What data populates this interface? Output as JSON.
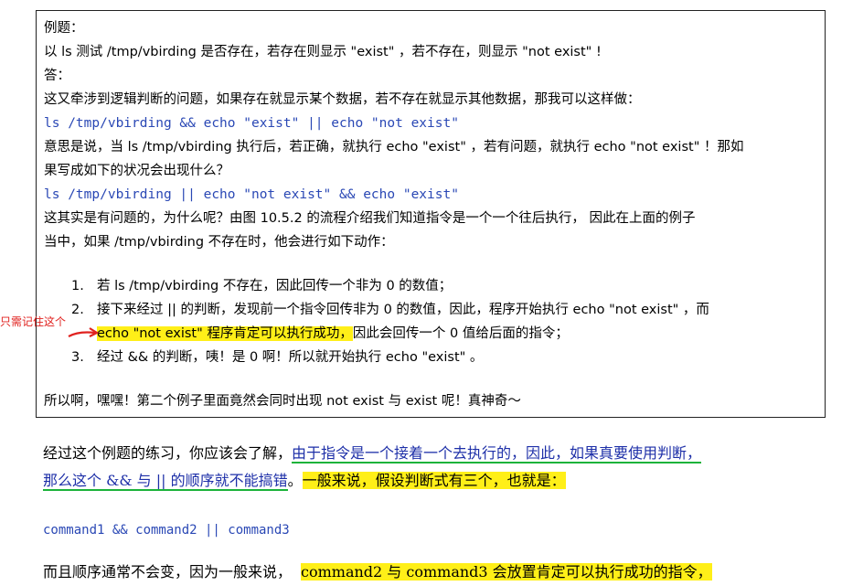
{
  "box": {
    "title": "例题：",
    "question": "以 ls 测试 /tmp/vbirding 是否存在，若存在则显示 \"exist\" ，若不存在，则显示 \"not exist\" !",
    "answer_label": "答：",
    "line1": "这又牵涉到逻辑判断的问题，如果存在就显示某个数据，若不存在就显示其他数据，那我可以这样做：",
    "code1": "ls /tmp/vbirding && echo \"exist\" || echo \"not exist\"",
    "line2a": "意思是说，当 ls /tmp/vbirding 执行后，若正确，就执行 echo \"exist\" ，若有问题，就执行 echo \"not exist\" ！那如",
    "line2b": "果写成如下的状况会出现什么？",
    "code2": "ls /tmp/vbirding || echo \"not exist\" && echo \"exist\"",
    "line3a": "这其实是有问题的，为什么呢？由图 10.5.2 的流程介绍我们知道指令是一个一个往后执行， 因此在上面的例子",
    "line3b": "当中，如果 /tmp/vbirding 不存在时，他会进行如下动作：",
    "items": [
      {
        "num": "1.",
        "text": "若 ls /tmp/vbirding 不存在，因此回传一个非为 0 的数值；"
      },
      {
        "num": "2.",
        "text": "接下来经过 || 的判断，发现前一个指令回传非为 0 的数值，因此，程序开始执行 echo \"not exist\" ，而"
      },
      {
        "num": "3.",
        "text": "经过 && 的判断，咦！是 0 啊！所以就开始执行 echo \"exist\" 。"
      }
    ],
    "item2_cont_highlight": "echo \"not exist\" 程序肯定可以执行成功，",
    "item2_cont_rest": "因此会回传一个 0 值给后面的指令；",
    "conclusion": "所以啊，嘿嘿！第二个例子里面竟然会同时出现 not exist 与 exist 呢！真神奇～"
  },
  "annotation": {
    "note": "只需记住这个",
    "arrow_color": "#e0221f"
  },
  "para1": {
    "pre": "经过这个例题的练习，你应该会了解，",
    "blue1": "由于指令是一个接着一个去执行的，因此，如果真要使用判断，",
    "blue2": "那么这个  &&  与  ||  的顺序就不能搞错",
    "post_plain": "。",
    "post_highlight": "一般来说，假设判断式有三个，也就是："
  },
  "code3": "command1 && command2 || command3",
  "para2": {
    "plain": "而且顺序通常不会变，因为一般来说，",
    "highlight": "command2 与 command3 会放置肯定可以执行成功的指令，"
  },
  "colors": {
    "highlight": "#ffef18",
    "code_blue": "#2a48b5",
    "underline_green": "#1bb33a",
    "note_red": "#e0221f"
  }
}
